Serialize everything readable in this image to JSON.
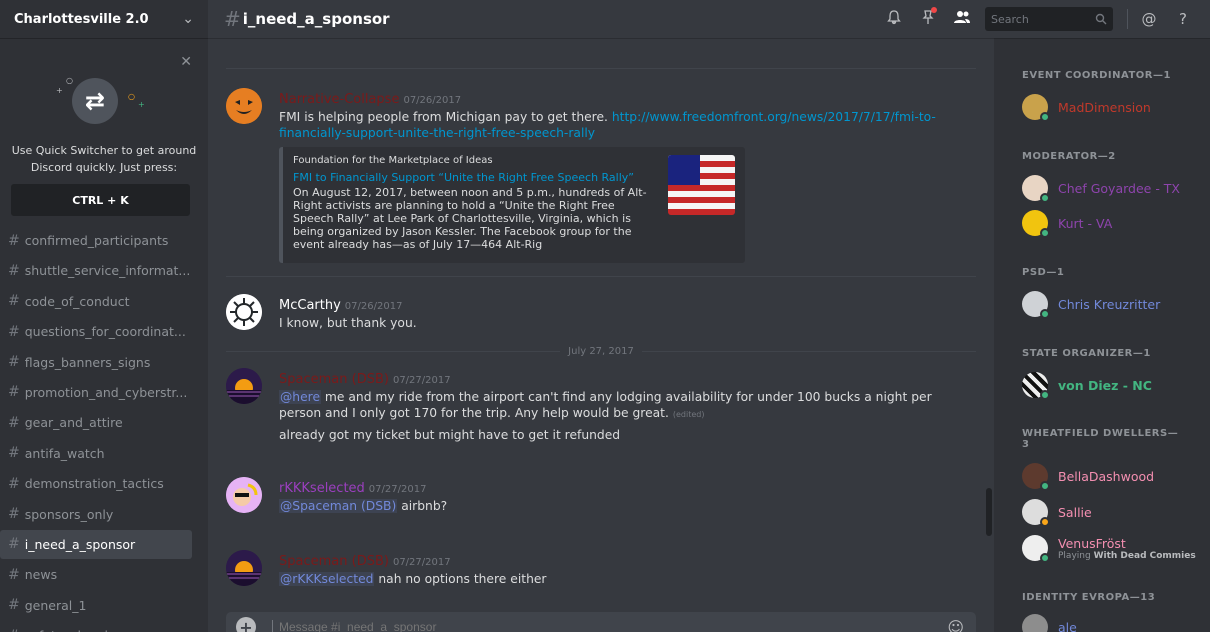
{
  "server": {
    "name": "Charlottesville 2.0"
  },
  "quick_switcher": {
    "text": "Use Quick Switcher to get around Discord quickly. Just press:",
    "key": "CTRL + K"
  },
  "channels": [
    {
      "name": "confirmed_participants",
      "active": false
    },
    {
      "name": "shuttle_service_informat...",
      "active": false
    },
    {
      "name": "code_of_conduct",
      "active": false
    },
    {
      "name": "questions_for_coordinat...",
      "active": false
    },
    {
      "name": "flags_banners_signs",
      "active": false
    },
    {
      "name": "promotion_and_cyberstr...",
      "active": false
    },
    {
      "name": "gear_and_attire",
      "active": false
    },
    {
      "name": "antifa_watch",
      "active": false
    },
    {
      "name": "demonstration_tactics",
      "active": false
    },
    {
      "name": "sponsors_only",
      "active": false
    },
    {
      "name": "i_need_a_sponsor",
      "active": true
    },
    {
      "name": "news",
      "active": false
    },
    {
      "name": "general_1",
      "active": false
    },
    {
      "name": "safety_planning",
      "active": false
    }
  ],
  "header": {
    "channel_name": "i_need_a_sponsor",
    "search_placeholder": "Search"
  },
  "messages": {
    "m1": {
      "author": "Narrative-Collapse",
      "author_color": "#7b1a1a",
      "timestamp": "07/26/2017",
      "text_before": "FMI is helping people from Michigan pay to get there. ",
      "link": "http://www.freedomfront.org/news/2017/7/17/fmi-to-financially-support-unite-the-right-free-speech-rally",
      "embed": {
        "provider": "Foundation for the Marketplace of Ideas",
        "title": "FMI to Financially Support “Unite the Right Free Speech Rally”",
        "description": "On August 12, 2017, between noon and 5 p.m., hundreds of Alt-Right activists are planning to hold a “Unite the Right Free Speech Rally” at Lee Park of Charlottesville, Virginia, which is being organized by Jason Kessler.  The Facebook group for the event already has—as of July 17—464 Alt-Rig"
      }
    },
    "m2": {
      "author": "McCarthy",
      "author_color": "#ffffff",
      "timestamp": "07/26/2017",
      "text": "I know, but thank you."
    },
    "date_divider": "July 27, 2017",
    "m3": {
      "author": "Spaceman (DSB)",
      "author_color": "#7b1a1a",
      "timestamp": "07/27/2017",
      "mention": "@here",
      "text": " me and my ride from the airport can't find any lodging availability for under 100 bucks a night per person and I only got 170 for the trip. Any help would be great.",
      "edited": "(edited)",
      "text2": "already got my ticket but might have to get it refunded"
    },
    "m4": {
      "author": "rKKKselected",
      "author_color": "#9b3fbf",
      "timestamp": "07/27/2017",
      "mention": "@Spaceman (DSB)",
      "text": " airbnb?"
    },
    "m5": {
      "author": "Spaceman (DSB)",
      "author_color": "#7b1a1a",
      "timestamp": "07/27/2017",
      "mention": "@rKKKselected",
      "text": " nah no options there either"
    }
  },
  "composer": {
    "placeholder": "Message #i_need_a_sponsor"
  },
  "members": {
    "event_coordinator": {
      "title": "EVENT COORDINATOR—1",
      "items": [
        {
          "name": "MadDimension",
          "color": "#c0392b"
        }
      ]
    },
    "moderator": {
      "title": "MODERATOR—2",
      "items": [
        {
          "name": "Chef Goyardee - TX",
          "color": "#8e44ad"
        },
        {
          "name": "Kurt - VA",
          "color": "#8e44ad"
        }
      ]
    },
    "psd": {
      "title": "PSD—1",
      "items": [
        {
          "name": "Chris Kreuzritter",
          "color": "#7289da"
        }
      ]
    },
    "state_organizer": {
      "title": "STATE ORGANIZER—1",
      "items": [
        {
          "name": "von Diez - NC",
          "color": "#43b581"
        }
      ]
    },
    "wheatfield": {
      "title": "WHEATFIELD DWELLERS—3",
      "items": [
        {
          "name": "BellaDashwood",
          "color": "#f48fb1"
        },
        {
          "name": "Sallie",
          "color": "#f48fb1"
        },
        {
          "name": "VenusFröst",
          "color": "#f48fb1",
          "activity_prefix": "Playing ",
          "activity": "With Dead Commies"
        }
      ]
    },
    "identity": {
      "title": "IDENTITY EVROPA—13",
      "items": [
        {
          "name": "ale",
          "color": "#7289da"
        }
      ]
    }
  }
}
